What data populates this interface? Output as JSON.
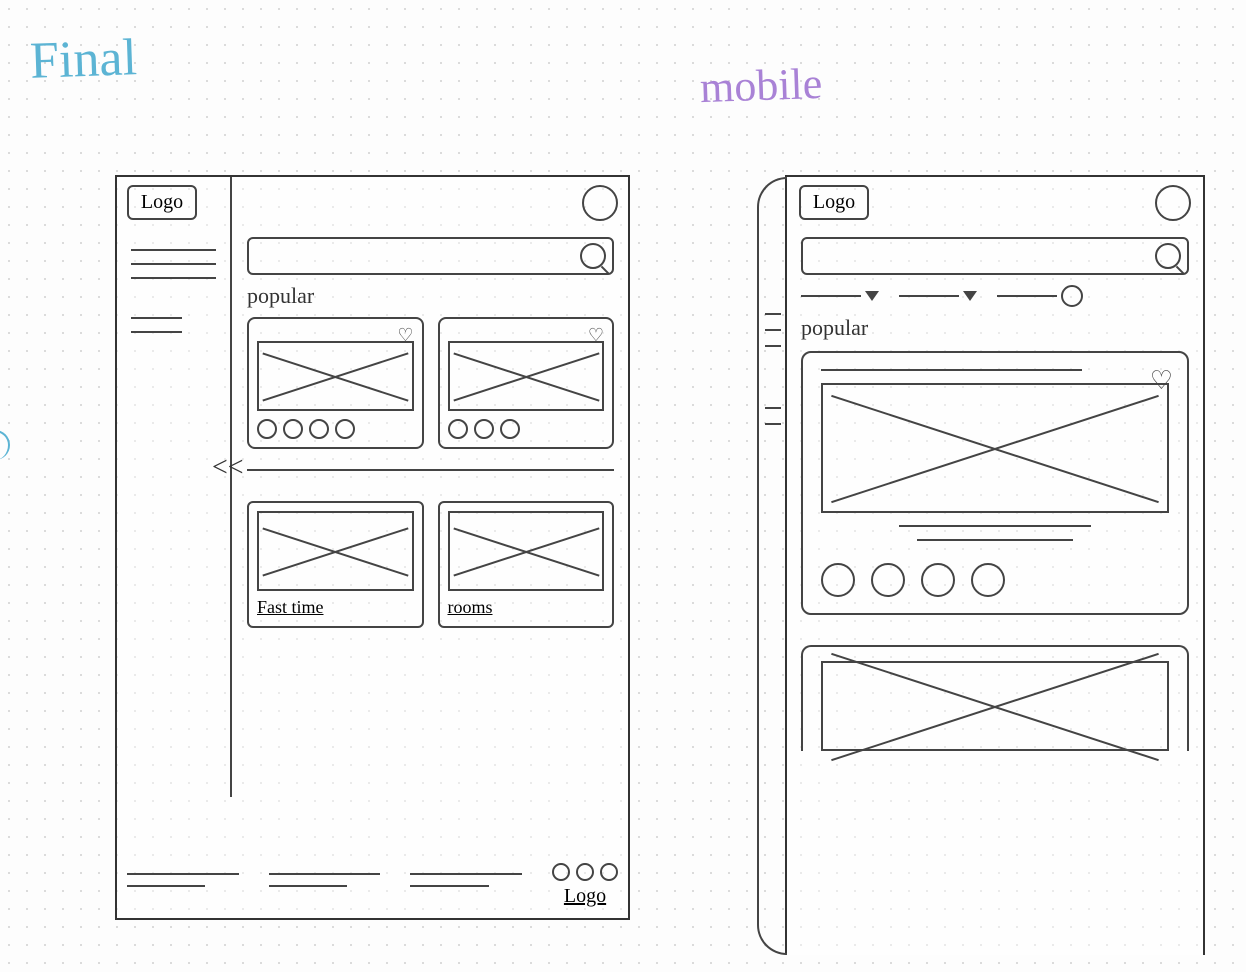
{
  "titles": {
    "final": "Final",
    "mobile": "mobile"
  },
  "desktop": {
    "logo": "Logo",
    "section_label": "popular",
    "arrow": "<<",
    "categories": [
      "Fast time",
      "rooms"
    ],
    "footer_logo": "Logo"
  },
  "mobile": {
    "logo": "Logo",
    "section_label": "popular"
  }
}
